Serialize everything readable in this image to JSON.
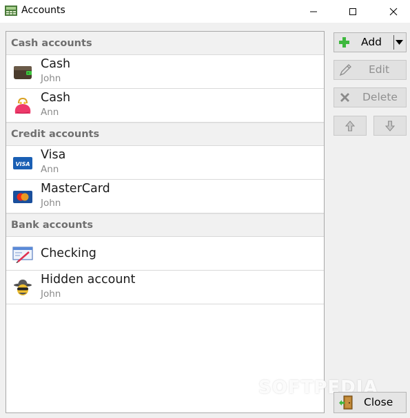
{
  "window": {
    "title": "Accounts"
  },
  "groups": [
    {
      "label": "Cash accounts",
      "items": [
        {
          "name": "Cash",
          "owner": "John",
          "icon": "wallet-icon"
        },
        {
          "name": "Cash",
          "owner": "Ann",
          "icon": "purse-icon"
        }
      ]
    },
    {
      "label": "Credit accounts",
      "items": [
        {
          "name": "Visa",
          "owner": "Ann",
          "icon": "visa-card-icon",
          "icon_text": "VISA"
        },
        {
          "name": "MasterCard",
          "owner": "John",
          "icon": "mastercard-icon"
        }
      ]
    },
    {
      "label": "Bank accounts",
      "items": [
        {
          "name": "Checking",
          "owner": "",
          "icon": "cheque-icon"
        },
        {
          "name": "Hidden account",
          "owner": "John",
          "icon": "spy-icon"
        }
      ]
    }
  ],
  "buttons": {
    "add": "Add",
    "edit": "Edit",
    "delete": "Delete",
    "close": "Close"
  },
  "watermark": "SOFTPEDIA",
  "colors": {
    "add_icon": "#3db83d",
    "disabled_text": "#8f8f8f",
    "group_header_text": "#6f6f6f"
  }
}
